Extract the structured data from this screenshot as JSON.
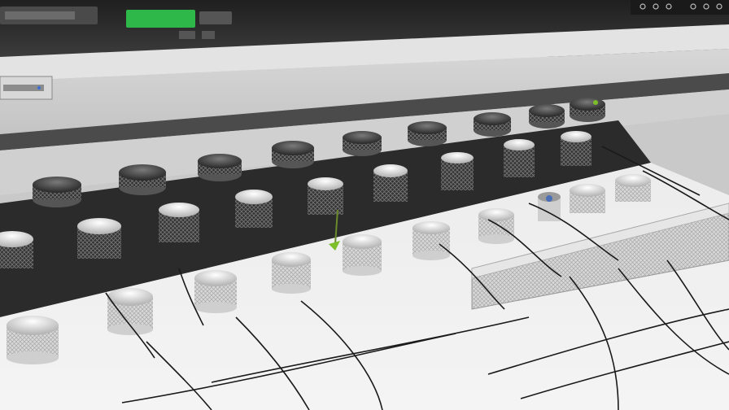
{
  "colors": {
    "console_dark": "#2a2a2a",
    "panel_white": "#e6e6e6",
    "accent_green": "#2fb84a",
    "knob_dark": "#3a3a3a",
    "knob_light": "#d9d9d9",
    "cable": "#1a1a1a"
  },
  "icons": [
    "window-controls-icon",
    "status-indicator-icon"
  ],
  "scene": {
    "top_left_label": "",
    "green_display": ""
  }
}
